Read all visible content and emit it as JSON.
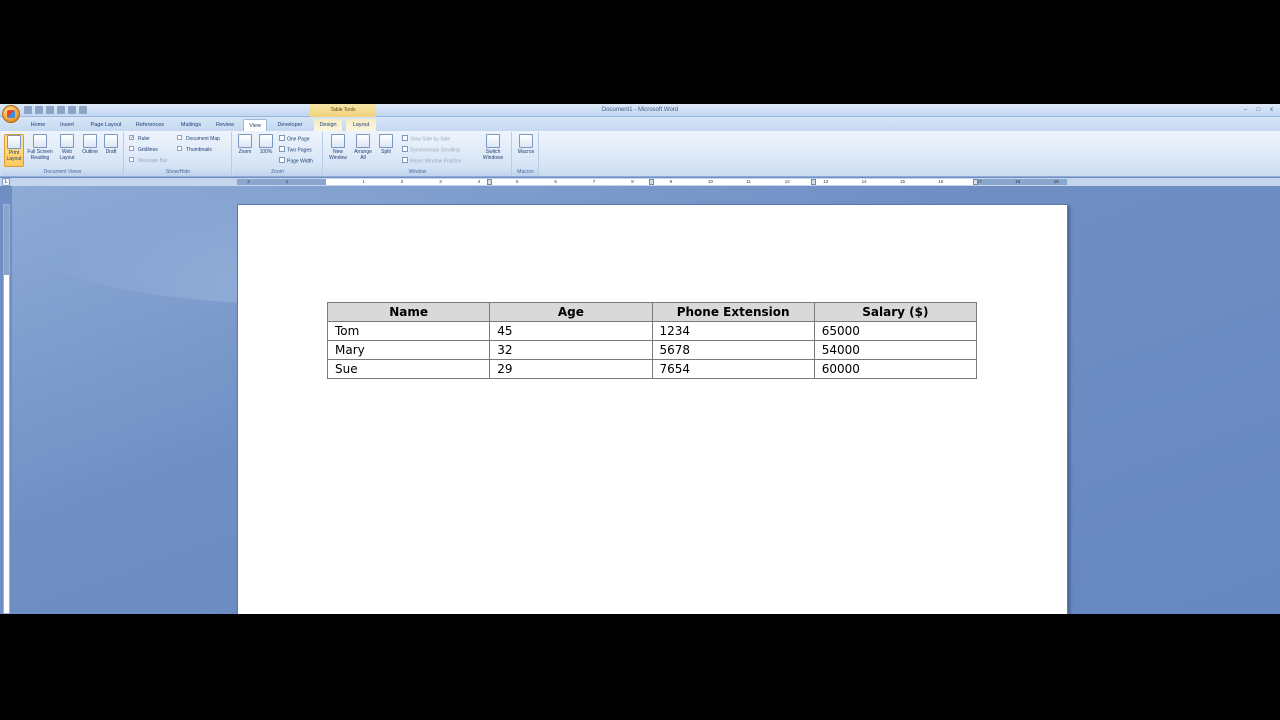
{
  "window": {
    "title": "Document1 - Microsoft Word",
    "context_tab_group": "Table Tools",
    "controls": {
      "minimize": "–",
      "maximize": "□",
      "close": "x"
    }
  },
  "tabs": [
    {
      "label": "Home"
    },
    {
      "label": "Insert"
    },
    {
      "label": "Page Layout"
    },
    {
      "label": "References"
    },
    {
      "label": "Mailings"
    },
    {
      "label": "Review"
    },
    {
      "label": "View",
      "active": true
    },
    {
      "label": "Developer"
    },
    {
      "label": "Design",
      "contextual": true
    },
    {
      "label": "Layout",
      "contextual": true
    }
  ],
  "ribbon": {
    "document_views": {
      "label": "Document Views",
      "print_layout": "Print Layout",
      "full_screen_reading": "Full Screen Reading",
      "web_layout": "Web Layout",
      "outline": "Outline",
      "draft": "Draft"
    },
    "show_hide": {
      "label": "Show/Hide",
      "ruler": {
        "label": "Ruler",
        "checked": true
      },
      "gridlines": {
        "label": "Gridlines",
        "checked": false
      },
      "message_bar": {
        "label": "Message Bar",
        "checked": false,
        "disabled": true
      },
      "document_map": {
        "label": "Document Map",
        "checked": false
      },
      "thumbnails": {
        "label": "Thumbnails",
        "checked": false
      }
    },
    "zoom": {
      "label": "Zoom",
      "zoom": "Zoom",
      "hundred": "100%",
      "one_page": "One Page",
      "two_pages": "Two Pages",
      "page_width": "Page Width"
    },
    "window": {
      "label": "Window",
      "new_window": "New Window",
      "arrange_all": "Arrange All",
      "split": "Split",
      "view_side_by_side": "View Side by Side",
      "synchronous_scrolling": "Synchronous Scrolling",
      "reset_window_position": "Reset Window Position",
      "switch_windows": "Switch Windows"
    },
    "macros": {
      "label": "Macros",
      "macros": "Macros"
    }
  },
  "ruler": {
    "left_numbers": [
      "2",
      "1"
    ],
    "numbers": [
      "1",
      "2",
      "3",
      "4",
      "5",
      "6",
      "7",
      "8",
      "9",
      "10",
      "11",
      "12",
      "13",
      "14",
      "15",
      "16",
      "17",
      "18",
      "19"
    ]
  },
  "table": {
    "columns": [
      "Name",
      "Age",
      "Phone Extension",
      "Salary ($)"
    ],
    "rows": [
      [
        "Tom",
        "45",
        "1234",
        "65000"
      ],
      [
        "Mary",
        "32",
        "5678",
        "54000"
      ],
      [
        "Sue",
        "29",
        "7654",
        "60000"
      ]
    ]
  }
}
